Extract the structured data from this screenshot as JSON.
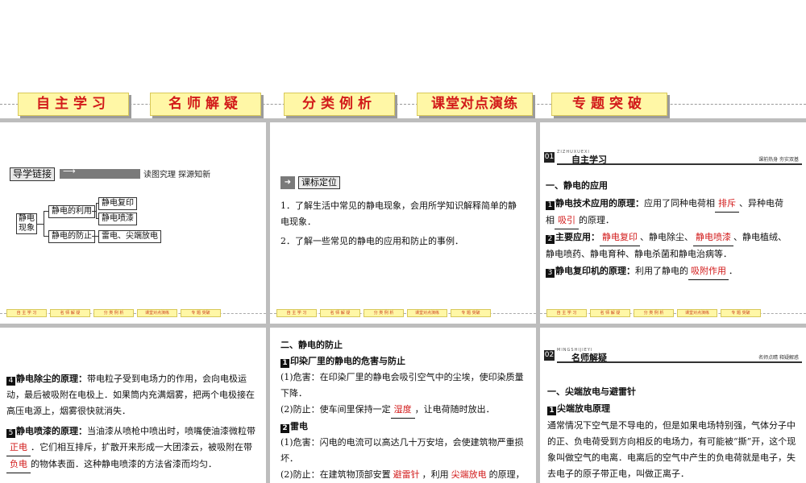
{
  "nav": {
    "tabs": [
      {
        "label": "自主学习"
      },
      {
        "label": "名师解疑"
      },
      {
        "label": "分类例析"
      },
      {
        "label": "课堂对点演练"
      },
      {
        "label": "专题突破"
      }
    ]
  },
  "mini_nav": [
    "自 主 学 习",
    "名 师 解 疑",
    "分 类 例 析",
    "课堂对点演练",
    "专 题 突破"
  ],
  "slide1": {
    "badge": "导学链接",
    "tagline": "读图究理  探源知新",
    "mindmap": {
      "root": "静电\n现象",
      "branch1": "静电的利用",
      "branch1_leaves": [
        "静电复印",
        "静电喷漆"
      ],
      "branch2": "静电的防止",
      "branch2_leaf": "雷电、尖端放电"
    }
  },
  "slide2": {
    "badge": "课标定位",
    "item1": "1．了解生活中常见的静电现象，会用所学知识解释简单的静电现象．",
    "item2": "2．了解一些常见的静电的应用和防止的事例．"
  },
  "slide3": {
    "section_num": "01",
    "section_pinyin": "ZIZHUXUEXI",
    "section_title": "自主学习",
    "section_side": "课前热身  夯实双基",
    "heading": "一、静电的应用",
    "p1_prefix": "静电技术应用的原理：",
    "p1_a": "应用了同种电荷相",
    "p1_b1": "排斥",
    "p1_c": "、异种电荷",
    "p1_d": "相",
    "p1_b2": "吸引",
    "p1_e": "的原理．",
    "p2_prefix": "主要应用：",
    "p2_b1": "静电复印",
    "p2_a": "、静电除尘、",
    "p2_b2": "静电喷漆",
    "p2_c": "、静电植绒、",
    "p2_d": "静电喷药、静电育种、静电杀菌和静电治病等．",
    "p3_prefix": "静电复印机的原理：",
    "p3_a": "利用了静电的",
    "p3_b": "吸附作用",
    "p3_c": "．"
  },
  "slide4": {
    "p4_prefix": "静电除尘的原理：",
    "p4_text": "带电粒子受到电场力的作用，会向电极运动，最后被吸附在电极上．如果筒内充满烟雾，把两个电极接在高压电源上，烟雾很快就消失．",
    "p5_prefix": "静电喷漆的原理：",
    "p5_a": "当油漆从喷枪中喷出时，喷嘴使油漆微粒带",
    "p5_b1": "正电",
    "p5_c": "．它们相互排斥，扩散开来形成一大团漆云，被吸附在带",
    "p5_b2": "负电",
    "p5_d": "的物体表面．这种静电喷漆的方法省漆而均匀．"
  },
  "slide5": {
    "heading": "二、静电的防止",
    "s1_title": "印染厂里的静电的危害与防止",
    "s1_harm": "(1)危害：在印染厂里的静电会吸引空气中的尘埃，使印染质量下降．",
    "s1_prev_a": "(2)防止：使车间里保持一定",
    "s1_prev_b": "湿度",
    "s1_prev_c": "，让电荷随时放出．",
    "s2_title": "雷电",
    "s2_harm": "(1)危害：闪电的电流可以高达几十万安培，会使建筑物严重损坏．",
    "s2_prev_a": "(2)防止：在建筑物顶部安置",
    "s2_prev_b": "避雷针",
    "s2_prev_c": "，利用",
    "s2_prev_d": "尖端放电",
    "s2_prev_e": "的原理，"
  },
  "slide6": {
    "section_num": "02",
    "section_pinyin": "MINGSHIJIEYI",
    "section_title": "名师解疑",
    "section_side": "名师点睛  释疑解惑",
    "heading": "一、尖端放电与避雷针",
    "s1_title": "尖端放电原理",
    "body": "通常情况下空气是不导电的，但是如果电场特别强，气体分子中的正、负电荷受到方向相反的电场力，有可能被“撕”开，这个现象叫做空气的电离．电离后的空气中产生的负电荷就是电子，失去电子的原子带正电，叫做正离子．"
  }
}
